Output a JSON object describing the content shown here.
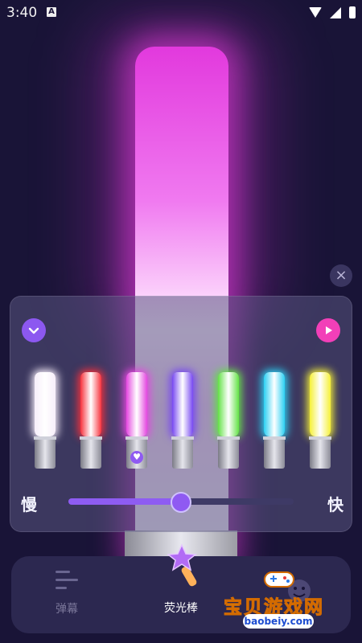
{
  "status_bar": {
    "time": "3:40",
    "notification_letter": "A"
  },
  "controls": {
    "close_label": "×"
  },
  "speed": {
    "slow_label": "慢",
    "fast_label": "快",
    "value_fraction": 0.5
  },
  "glow_sticks": [
    {
      "name": "white",
      "color": "#f7eefa",
      "selected": false
    },
    {
      "name": "red",
      "color": "#f7323d",
      "selected": false
    },
    {
      "name": "pink",
      "color": "#e447e0",
      "selected": true
    },
    {
      "name": "purple",
      "color": "#7748f1",
      "selected": false
    },
    {
      "name": "green",
      "color": "#63e246",
      "selected": false
    },
    {
      "name": "cyan",
      "color": "#2bd0f3",
      "selected": false
    },
    {
      "name": "yellow",
      "color": "#f5f037",
      "selected": false
    }
  ],
  "nav": {
    "items": [
      {
        "label": "弹幕",
        "active": false
      },
      {
        "label": "荧光棒",
        "active": true
      }
    ]
  },
  "watermark": {
    "title": "宝贝游戏网",
    "url": "baobeiy.com"
  },
  "colors": {
    "background": "#191437",
    "accent_purple": "#8f5af2",
    "accent_pink": "#f23fb8",
    "main_glow": "#e239dd"
  }
}
